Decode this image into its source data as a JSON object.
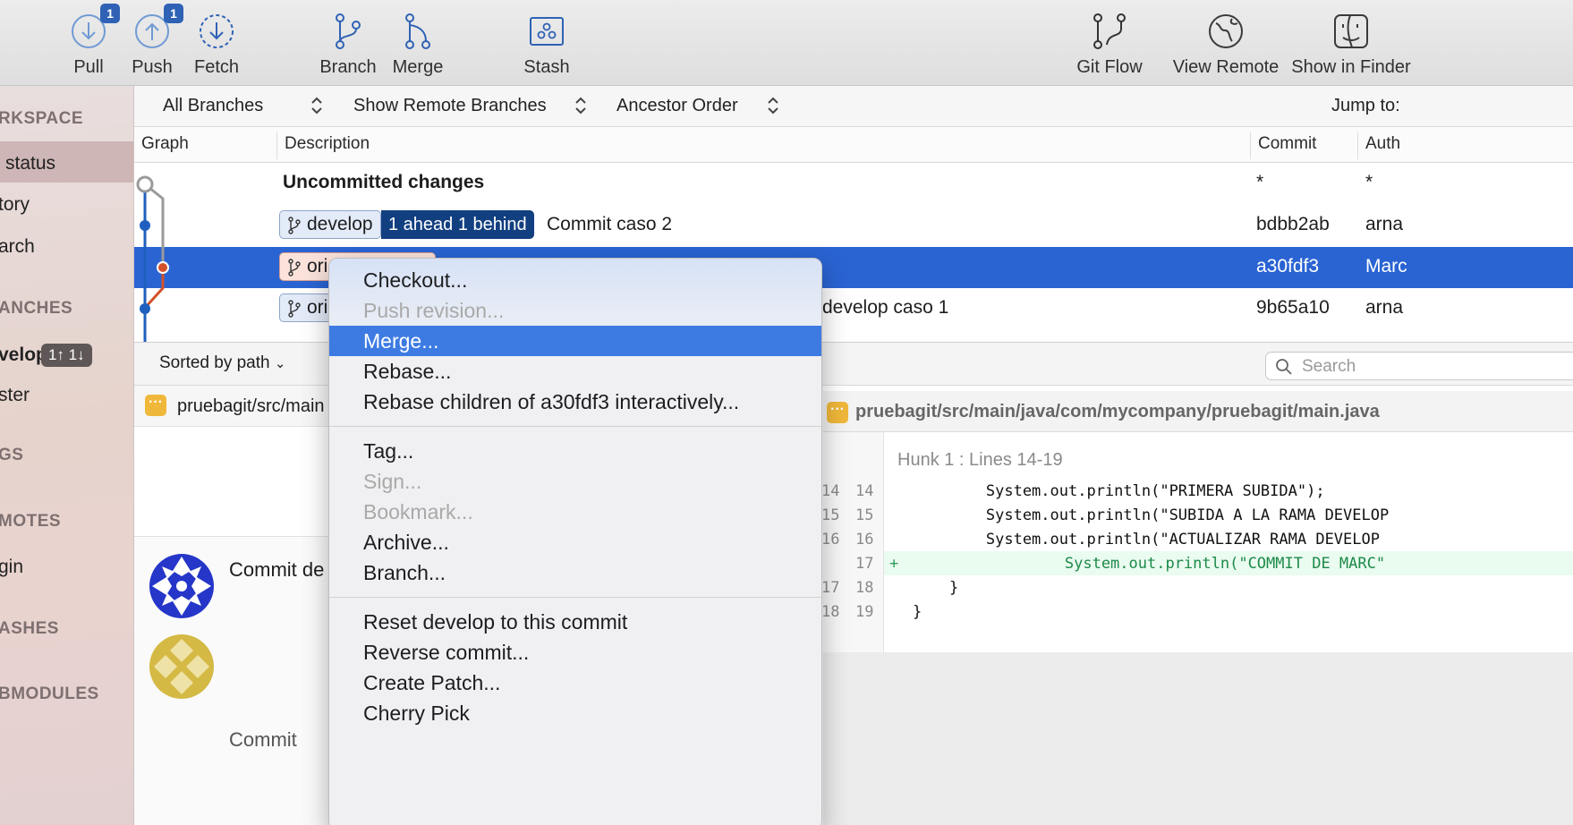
{
  "toolbar": {
    "pull_label": "Pull",
    "pull_badge": "1",
    "push_label": "Push",
    "push_badge": "1",
    "fetch_label": "Fetch",
    "branch_label": "Branch",
    "merge_label": "Merge",
    "stash_label": "Stash",
    "gitflow_label": "Git Flow",
    "view_remote_label": "View Remote",
    "show_in_finder_label": "Show in Finder"
  },
  "sidebar": {
    "workspace_header": "RKSPACE",
    "status_item": "status",
    "history_item": "tory",
    "search_item": "arch",
    "branches_header": "ANCHES",
    "develop_branch": "velop",
    "develop_badge": "1↑ 1↓",
    "master_branch": "ster",
    "tags_header": "GS",
    "remotes_header": "MOTES",
    "origin_item": "gin",
    "stashes_header": "ASHES",
    "submodules_header": "BMODULES"
  },
  "filterbar": {
    "branches": "All Branches",
    "remote": "Show Remote Branches",
    "order": "Ancestor Order",
    "jump": "Jump to:"
  },
  "columns": {
    "graph": "Graph",
    "description": "Description",
    "commit": "Commit",
    "author": "Auth"
  },
  "commits": [
    {
      "description": "Uncommitted changes",
      "commit": "*",
      "author": "*"
    },
    {
      "tag": "develop",
      "ahead_behind": "1 ahead 1 behind",
      "description": "Commit caso 2",
      "commit": "bdbb2ab",
      "author": "arna"
    },
    {
      "tag": "ori",
      "description": "",
      "commit": "a30fdf3",
      "author": "Marc"
    },
    {
      "tag": "ori",
      "description": "develop caso 1",
      "commit": "9b65a10",
      "author": "arna"
    }
  ],
  "lower": {
    "sort_label": "Sorted by path",
    "search_placeholder": "Search",
    "file_path_short": "pruebagit/src/main",
    "commit_message": "Commit de",
    "commit_bottom": "Commit"
  },
  "diff": {
    "file_path": "pruebagit/src/main/java/com/mycompany/pruebagit/main.java",
    "hunk": "Hunk 1 : Lines 14-19",
    "lines": [
      {
        "old": "14",
        "new": "14",
        "sign": "",
        "code": "        System.out.println(\"PRIMERA SUBIDA\");"
      },
      {
        "old": "15",
        "new": "15",
        "sign": "",
        "code": "        System.out.println(\"SUBIDA A LA RAMA DEVELOP"
      },
      {
        "old": "16",
        "new": "16",
        "sign": "",
        "code": "        System.out.println(\"ACTUALIZAR RAMA DEVELOP"
      },
      {
        "old": "",
        "new": "17",
        "sign": "+",
        "code": "        System.out.println(\"COMMIT DE MARC\""
      },
      {
        "old": "17",
        "new": "18",
        "sign": "",
        "code": "    }"
      },
      {
        "old": "18",
        "new": "19",
        "sign": "",
        "code": "}"
      }
    ]
  },
  "context_menu": {
    "checkout": "Checkout...",
    "push_revision": "Push revision...",
    "merge": "Merge...",
    "rebase": "Rebase...",
    "rebase_children": "Rebase children of a30fdf3 interactively...",
    "tag": "Tag...",
    "sign": "Sign...",
    "bookmark": "Bookmark...",
    "archive": "Archive...",
    "branch": "Branch...",
    "reset": "Reset develop to this commit",
    "reverse": "Reverse commit...",
    "create_patch": "Create Patch...",
    "cherry_pick": "Cherry Pick"
  },
  "colors": {
    "accent": "#2a64d3",
    "menu_highlight": "#3d7be3",
    "graph_blue": "#1f5fbf",
    "graph_orange": "#d2512a",
    "added_line": "#eafbef"
  }
}
